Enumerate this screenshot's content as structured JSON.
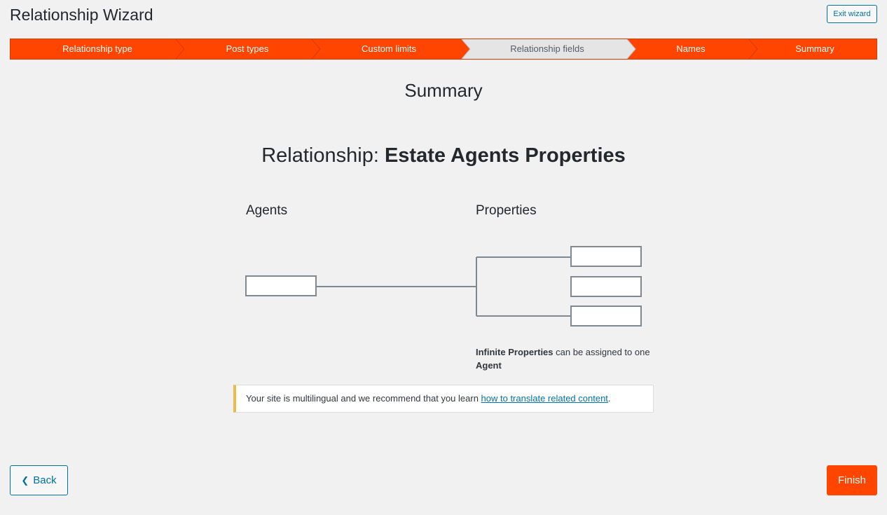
{
  "header": {
    "title": "Relationship Wizard",
    "exit_label": "Exit wizard"
  },
  "steps": [
    {
      "label": "Relationship type",
      "state": "active"
    },
    {
      "label": "Post types",
      "state": "active"
    },
    {
      "label": "Custom limits",
      "state": "active"
    },
    {
      "label": "Relationship fields",
      "state": "inactive"
    },
    {
      "label": "Names",
      "state": "active"
    },
    {
      "label": "Summary",
      "state": "active"
    }
  ],
  "main": {
    "heading": "Summary",
    "relationship_prefix": "Relationship: ",
    "relationship_name": "Estate Agents Properties",
    "left_label": "Agents",
    "right_label": "Properties",
    "description": {
      "part1_bold": "Infinite Properties",
      "part2": " can be assigned to one ",
      "part3_bold": "Agent"
    }
  },
  "notice": {
    "text_before": "Your site is multilingual and we recommend that you learn ",
    "link_text": "how to translate related content",
    "text_after": "."
  },
  "footer": {
    "back_label": "Back",
    "finish_label": "Finish"
  },
  "colors": {
    "accent": "#ff4500",
    "inactive_step": "#e5e5e5",
    "link": "#0073aa",
    "notice_border": "#f0b849"
  }
}
